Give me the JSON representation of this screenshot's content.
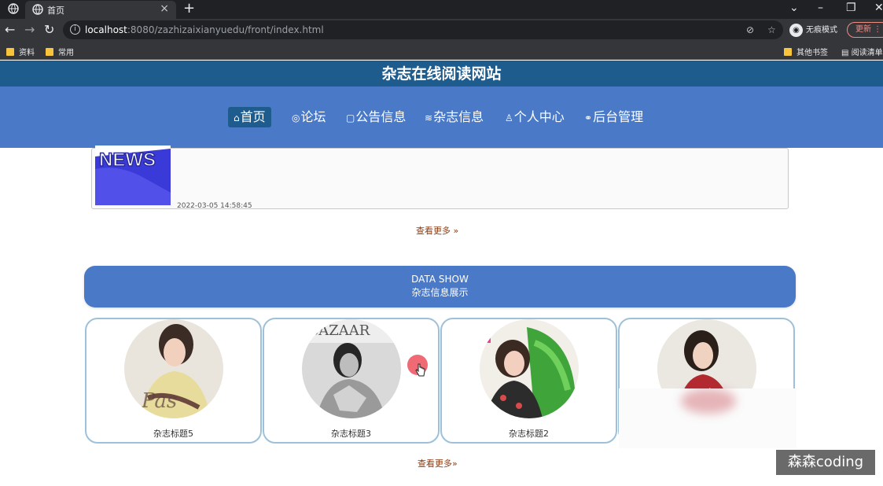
{
  "browser": {
    "tab_title": "首页",
    "url_host": "localhost",
    "url_path": ":8080/zazhizaixianyuedu/front/index.html",
    "profile_label": "无痕模式",
    "update_label": "更新",
    "bookmarks": [
      "资料",
      "常用"
    ],
    "bookmarks_right": [
      "其他书签",
      "阅读清单"
    ]
  },
  "site": {
    "title": "杂志在线阅读网站",
    "nav": [
      {
        "label": "首页",
        "icon": "home-icon",
        "glyph": "⌂"
      },
      {
        "label": "论坛",
        "icon": "forum-icon",
        "glyph": "◎"
      },
      {
        "label": "公告信息",
        "icon": "notice-icon",
        "glyph": "▢"
      },
      {
        "label": "杂志信息",
        "icon": "list-icon",
        "glyph": "≋"
      },
      {
        "label": "个人中心",
        "icon": "user-icon",
        "glyph": "♙"
      },
      {
        "label": "后台管理",
        "icon": "link-icon",
        "glyph": "⚭"
      }
    ]
  },
  "news": {
    "thumb_text": "NEWS",
    "date": "2022-03-05 14:58:45",
    "more": "查看更多 »"
  },
  "section": {
    "en": "DATA SHOW",
    "cn": "杂志信息展示"
  },
  "magazines": [
    {
      "title": "杂志标题5"
    },
    {
      "title": "杂志标题3"
    },
    {
      "title": "杂志标题2"
    },
    {
      "title": ""
    }
  ],
  "more2": "查看更多»",
  "watermark": "森森coding",
  "colors": {
    "header": "#1e5c8e",
    "nav": "#4a79c7",
    "accent_link": "#8a3b12"
  }
}
